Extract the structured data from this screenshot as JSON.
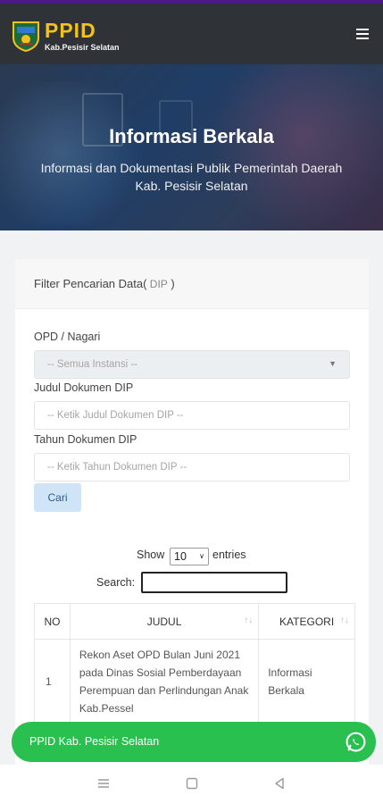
{
  "header": {
    "brand": "PPID",
    "brand_sub": "Kab.Pesisir Selatan",
    "logo_icon": "regency-emblem-icon",
    "menu_icon": "hamburger-menu-icon"
  },
  "hero": {
    "title": "Informasi Berkala",
    "subtitle_line1": "Informasi dan Dokumentasi Publik Pemerintah Daerah",
    "subtitle_line2": "Kab. Pesisir Selatan"
  },
  "filter": {
    "heading": "Filter Pencarian Data(",
    "heading_tag": " DIP",
    "heading_close": " )",
    "opd_label": "OPD / Nagari",
    "opd_value": "-- Semua Instansi --",
    "judul_label": "Judul Dokumen DIP",
    "judul_placeholder": "-- Ketik Judul Dokumen DIP --",
    "tahun_label": "Tahun Dokumen DIP",
    "tahun_placeholder": "-- Ketik Tahun Dokumen DIP --",
    "search_button": "Cari"
  },
  "table_controls": {
    "show_label": "Show",
    "show_value": "10",
    "entries_label": "entries",
    "search_label": "Search:"
  },
  "table": {
    "headers": [
      "NO",
      "JUDUL",
      "KATEGORI"
    ],
    "rows": [
      {
        "no": "1",
        "judul": "Rekon Aset OPD Bulan Juni 2021 pada Dinas Sosial Pemberdayaan Perempuan dan Perlindungan Anak Kab.Pessel",
        "kategori": "Informasi Berkala"
      }
    ]
  },
  "whatsapp": {
    "label": "PPID Kab. Pesisir Selatan",
    "icon": "whatsapp-icon"
  },
  "colors": {
    "brand_yellow": "#f3c31d",
    "topbar": "#2f3236",
    "whatsapp_green": "#29c04f",
    "button_blue": "#cfe5f7"
  }
}
